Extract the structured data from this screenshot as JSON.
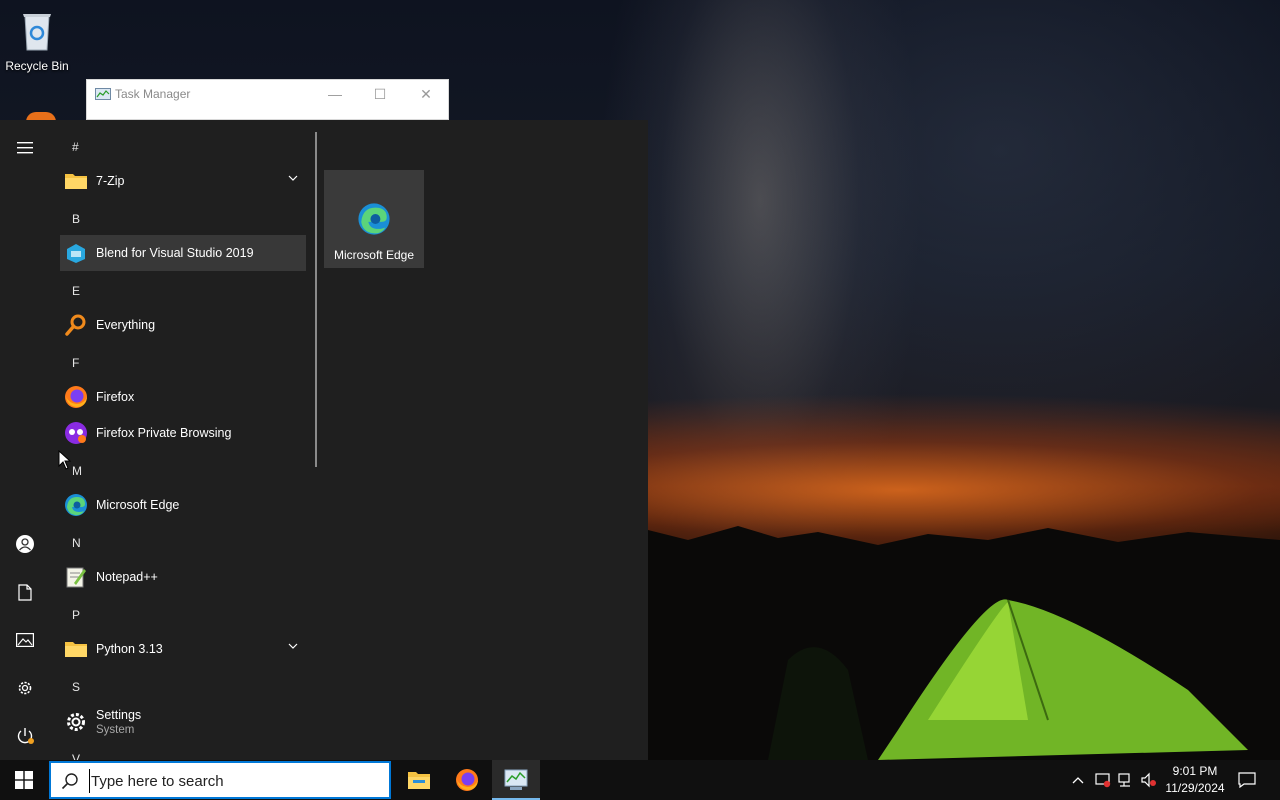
{
  "desktop": {
    "recycle_bin_label": "Recycle Bin"
  },
  "task_manager": {
    "title": "Task Manager",
    "minimize": "—",
    "maximize": "☐",
    "close": "✕"
  },
  "start_menu": {
    "sections": [
      {
        "letter": "#",
        "apps": [
          {
            "label": "7-Zip",
            "icon": "folder-icon",
            "expandable": true
          }
        ]
      },
      {
        "letter": "B",
        "apps": [
          {
            "label": "Blend for Visual Studio 2019",
            "icon": "blend-icon",
            "hovered": true
          }
        ]
      },
      {
        "letter": "E",
        "apps": [
          {
            "label": "Everything",
            "icon": "everything-search-icon"
          }
        ]
      },
      {
        "letter": "F",
        "apps": [
          {
            "label": "Firefox",
            "icon": "firefox-icon"
          },
          {
            "label": "Firefox Private Browsing",
            "icon": "firefox-private-icon"
          }
        ]
      },
      {
        "letter": "M",
        "apps": [
          {
            "label": "Microsoft Edge",
            "icon": "edge-icon"
          }
        ]
      },
      {
        "letter": "N",
        "apps": [
          {
            "label": "Notepad++",
            "icon": "notepadpp-icon"
          }
        ]
      },
      {
        "letter": "P",
        "apps": [
          {
            "label": "Python 3.13",
            "icon": "folder-icon",
            "expandable": true
          }
        ]
      },
      {
        "letter": "S",
        "apps": [
          {
            "label": "Settings",
            "sublabel": "System",
            "icon": "gear-icon"
          }
        ]
      },
      {
        "letter": "V",
        "apps": []
      }
    ],
    "pinned_tile": {
      "label": "Microsoft Edge",
      "icon": "edge-icon"
    },
    "rail": [
      "hamburger-menu-icon",
      "user-account-icon",
      "documents-icon",
      "pictures-icon",
      "settings-gear-icon",
      "power-icon"
    ]
  },
  "taskbar": {
    "search_placeholder": "Type here to search",
    "pinned": [
      "file-explorer-icon",
      "firefox-icon",
      "task-manager-icon"
    ],
    "clock_time": "9:01 PM",
    "clock_date": "11/29/2024"
  },
  "colors": {
    "start_bg": "#1f1f1f",
    "taskbar_bg": "#101010",
    "accent": "#0078d7"
  }
}
